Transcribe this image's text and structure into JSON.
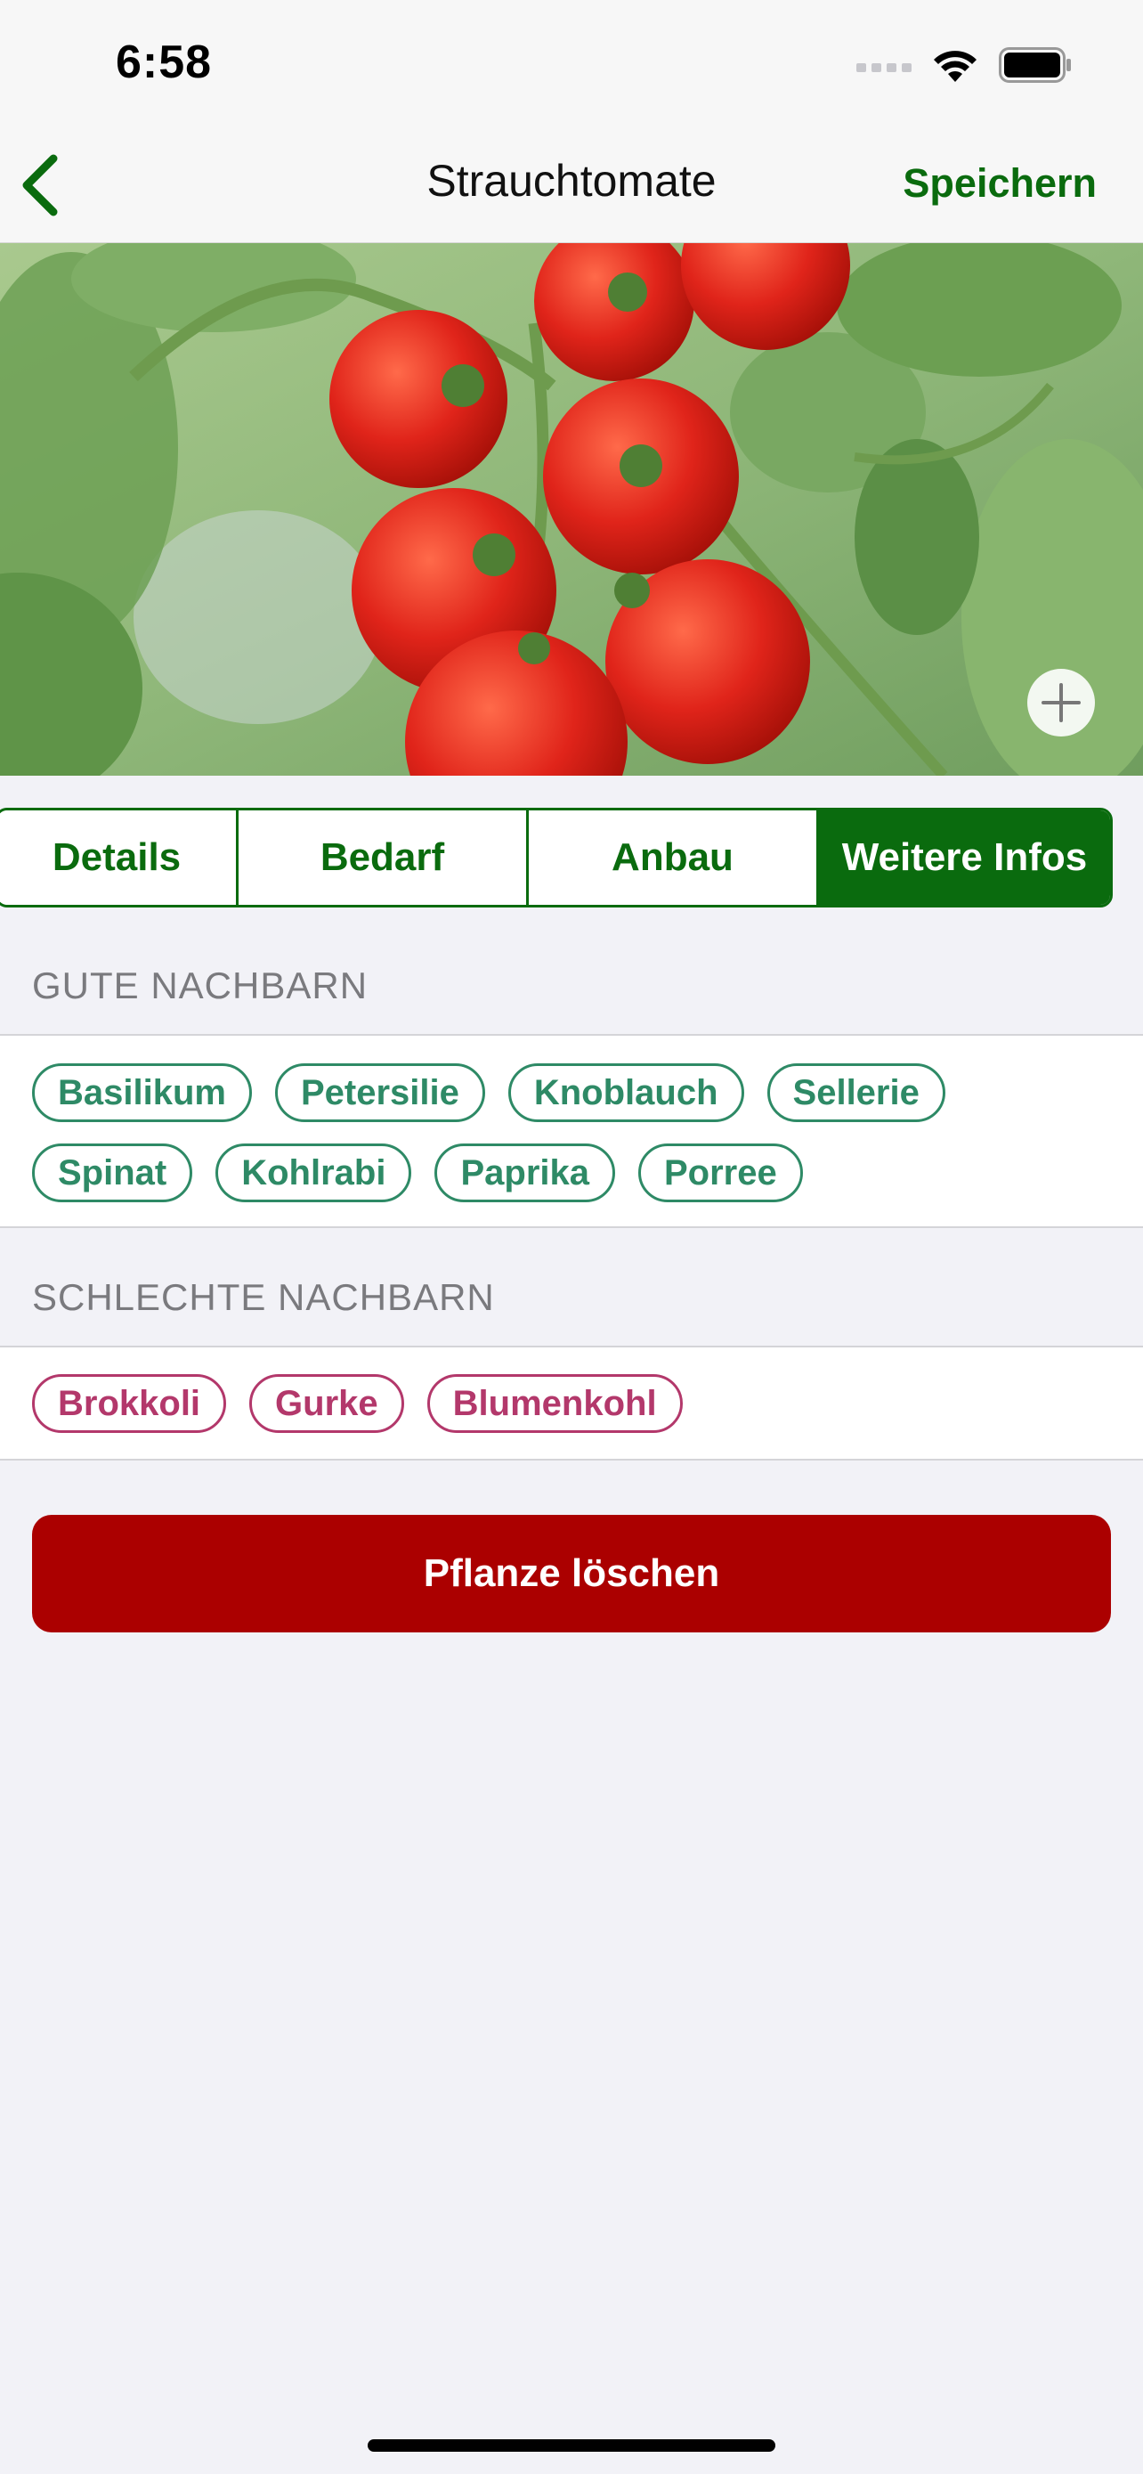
{
  "status_bar": {
    "time": "6:58"
  },
  "nav": {
    "title": "Strauchtomate",
    "save_label": "Speichern"
  },
  "tabs": [
    {
      "label": "Details",
      "active": false
    },
    {
      "label": "Bedarf",
      "active": false
    },
    {
      "label": "Anbau",
      "active": false
    },
    {
      "label": "Weitere Infos",
      "active": true
    }
  ],
  "good_neighbors": {
    "header": "GUTE NACHBARN",
    "items": [
      "Basilikum",
      "Petersilie",
      "Knoblauch",
      "Sellerie",
      "Spinat",
      "Kohlrabi",
      "Paprika",
      "Porree"
    ]
  },
  "bad_neighbors": {
    "header": "SCHLECHTE NACHBARN",
    "items": [
      "Brokkoli",
      "Gurke",
      "Blumenkohl"
    ]
  },
  "delete_label": "Pflanze löschen",
  "colors": {
    "accent": "#0a6b0e",
    "good_chip": "#2e8a66",
    "bad_chip": "#b3386b",
    "delete": "#ab0000"
  }
}
